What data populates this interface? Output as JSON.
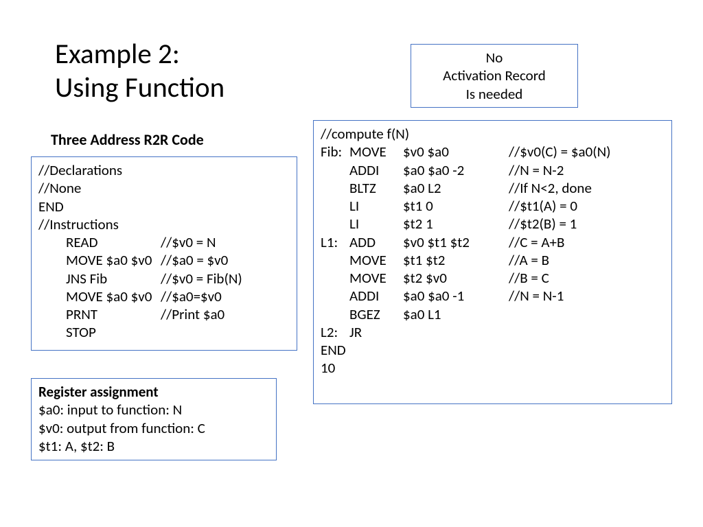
{
  "title_line1": "Example 2:",
  "title_line2": "Using Function",
  "note_line1": "No",
  "note_line2": "Activation Record",
  "note_line3": "Is needed",
  "subhead": "Three Address R2R Code",
  "left": {
    "l1": "//Declarations",
    "l2": "//None",
    "l3": "END",
    "l4": "//Instructions",
    "r1_op": "READ",
    "r1_cmnt": "//$v0 = N",
    "r2_op": "MOVE $a0 $v0",
    "r2_cmnt": "//$a0 = $v0",
    "r3_op": "JNS Fib",
    "r3_cmnt": "//$v0 = Fib(N)",
    "r4_op": "MOVE $a0 $v0",
    "r4_cmnt": "//$a0=$v0",
    "r5_op": "PRNT",
    "r5_cmnt": "//Print $a0",
    "r6_op": "STOP",
    "r6_cmnt": ""
  },
  "right": {
    "hdr": "//compute f(N)",
    "r01": {
      "lbl": "Fib:",
      "op": "MOVE",
      "args": "$v0  $a0",
      "cmnt": "//$v0(C) = $a0(N)"
    },
    "r02": {
      "lbl": "",
      "op": "ADDI",
      "args": "$a0  $a0  -2",
      "cmnt": "//N = N-2"
    },
    "r03": {
      "lbl": "",
      "op": "BLTZ",
      "args": "$a0  L2",
      "cmnt": "//If N<2, done"
    },
    "r04": {
      "lbl": "",
      "op": "LI",
      "args": "$t1  0",
      "cmnt": "//$t1(A) = 0"
    },
    "r05": {
      "lbl": "",
      "op": "LI",
      "args": "$t2  1",
      "cmnt": "//$t2(B) = 1"
    },
    "r06": {
      "lbl": "L1:",
      "op": "ADD",
      "args": "$v0  $t1   $t2",
      "cmnt": "//C = A+B"
    },
    "r07": {
      "lbl": "",
      "op": "MOVE",
      "args": "$t1  $t2",
      "cmnt": "//A = B"
    },
    "r08": {
      "lbl": "",
      "op": "MOVE",
      "args": "$t2  $v0",
      "cmnt": "//B = C"
    },
    "r09": {
      "lbl": "",
      "op": "ADDI",
      "args": "$a0  $a0 -1",
      "cmnt": "//N = N-1"
    },
    "r10": {
      "lbl": "",
      "op": "BGEZ",
      "args": "$a0  L1",
      "cmnt": ""
    },
    "r11": {
      "lbl": "L2:",
      "op": "JR",
      "args": "",
      "cmnt": ""
    },
    "end": "END",
    "val": "10"
  },
  "reg": {
    "hdr": "Register assignment",
    "l1": "$a0: input to function: N",
    "l2": "$v0: output from function: C",
    "l3": "$t1: A, $t2: B"
  }
}
